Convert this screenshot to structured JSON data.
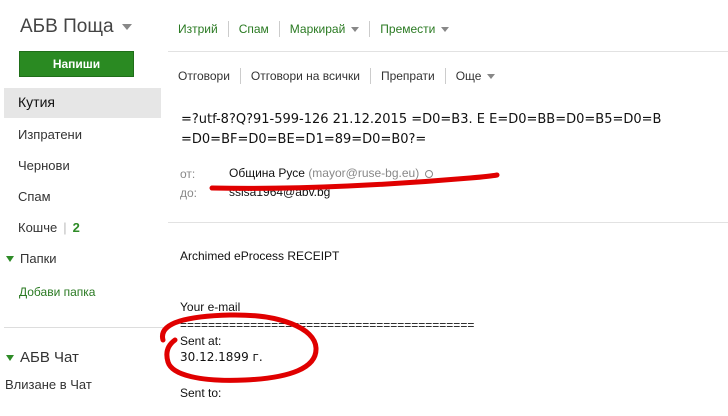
{
  "app": {
    "title": "АБВ Поща"
  },
  "sidebar": {
    "compose_label": "Напиши",
    "items": [
      {
        "label": "Кутия"
      },
      {
        "label": "Изпратени"
      },
      {
        "label": "Чернови"
      },
      {
        "label": "Спам"
      },
      {
        "label": "Кошче",
        "count": "2"
      }
    ],
    "folders_label": "Папки",
    "add_folder_label": "Добави папка",
    "chat_label": "АБВ Чат",
    "chat_login_label": "Влизане в Чат"
  },
  "toolbar1": {
    "delete": "Изтрий",
    "spam": "Спам",
    "mark": "Маркирай",
    "move": "Премести"
  },
  "toolbar2": {
    "reply": "Отговори",
    "reply_all": "Отговори на всички",
    "forward": "Препрати",
    "more": "Още"
  },
  "message": {
    "subject_line1": "=?utf-8?Q?91-599-126 21.12.2015 =D0=B3. E E=D0=BB=D0=B5=D0=B",
    "subject_line2": "=D0=BF=D0=BE=D1=89=D0=B0?=",
    "from_label": "от:",
    "from_name": "Община Русе",
    "from_email": "(mayor@ruse-bg.eu)",
    "to_label": "до:",
    "to_value": "sslsa1964@abv.bg",
    "body": {
      "line1": "Archimed eProcess RECEIPT",
      "line2": "Your e-mail",
      "separator": "==========================================",
      "sent_at_label": "Sent at:",
      "sent_at_value": "30.12.1899 г.",
      "sent_to_label": "Sent to:"
    }
  },
  "colors": {
    "brand_green": "#2a8a22",
    "link_green": "#2a7a22",
    "annotation_red": "#e00000"
  }
}
